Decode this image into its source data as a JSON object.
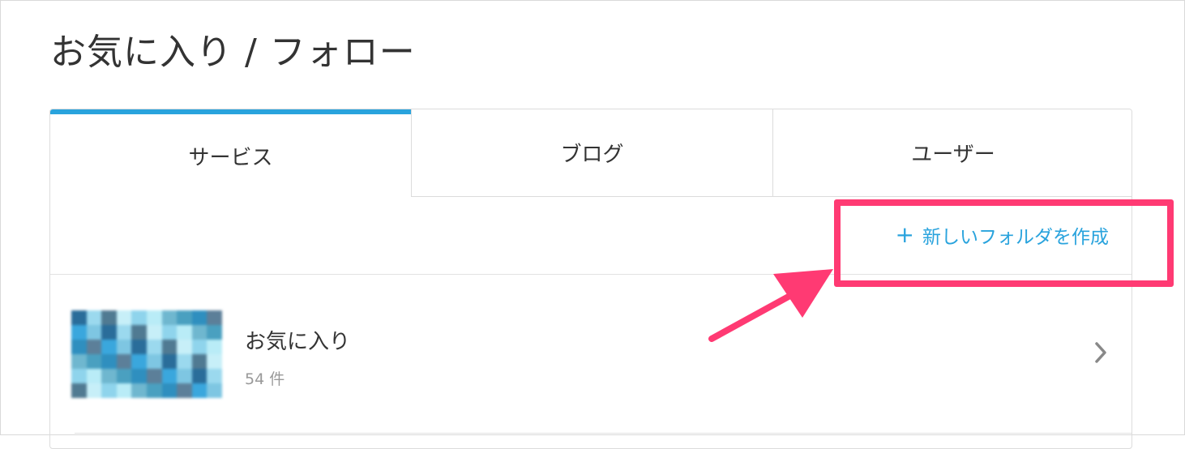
{
  "page": {
    "title": "お気に入り / フォロー"
  },
  "tabs": [
    {
      "label": "サービス",
      "active": true
    },
    {
      "label": "ブログ",
      "active": false
    },
    {
      "label": "ユーザー",
      "active": false
    }
  ],
  "toolbar": {
    "new_folder_label": "新しいフォルダを作成",
    "plus_icon": "plus-icon"
  },
  "folders": [
    {
      "name": "お気に入り",
      "count": "54 件",
      "thumbnail": "pixelated-thumbnail"
    }
  ],
  "colors": {
    "accent": "#29a3dd",
    "annotation": "#ff3a73",
    "text": "#333333",
    "muted": "#999999",
    "border": "#dcdcdc"
  }
}
